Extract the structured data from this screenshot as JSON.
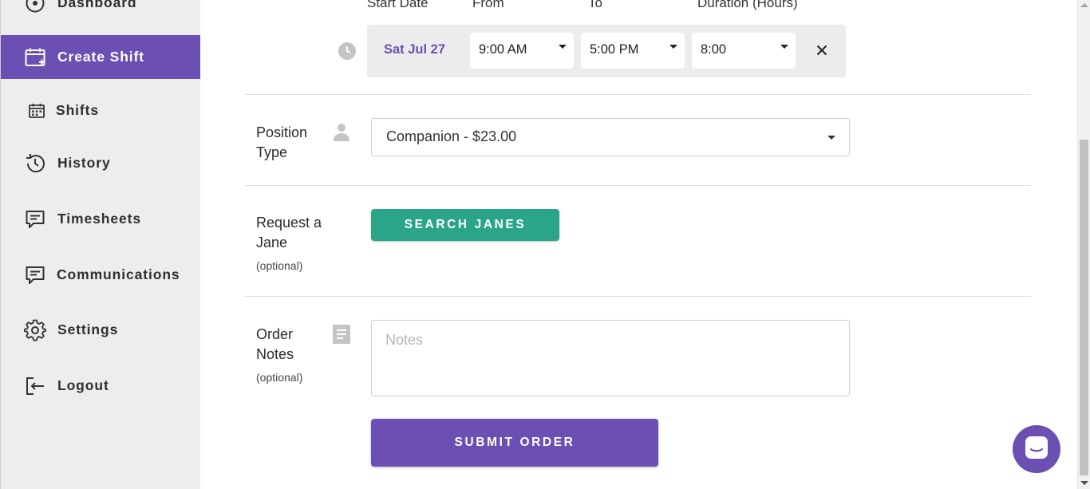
{
  "sidebar": {
    "items": [
      {
        "label": "Dashboard",
        "icon": "dashboard-icon",
        "active": false
      },
      {
        "label": "Create Shift",
        "icon": "calendar-plus-icon",
        "active": true
      },
      {
        "label": "Shifts",
        "icon": "calendar-icon",
        "active": false
      },
      {
        "label": "History",
        "icon": "history-icon",
        "active": false
      },
      {
        "label": "Timesheets",
        "icon": "timesheet-icon",
        "active": false
      },
      {
        "label": "Communications",
        "icon": "message-icon",
        "active": false
      },
      {
        "label": "Settings",
        "icon": "gear-icon",
        "active": false
      },
      {
        "label": "Logout",
        "icon": "logout-icon",
        "active": false
      }
    ]
  },
  "shift": {
    "headers": {
      "start_date": "Start Date",
      "from": "From",
      "to": "To",
      "duration": "Duration (Hours)"
    },
    "date": "Sat Jul 27",
    "from": "9:00 AM",
    "to": "5:00 PM",
    "duration": "8:00"
  },
  "position": {
    "label_line1": "Position",
    "label_line2": "Type",
    "value": "Companion - $23.00"
  },
  "request": {
    "label_line1": "Request a",
    "label_line2": "Jane",
    "optional": "(optional)",
    "button": "SEARCH JANES"
  },
  "notes": {
    "label_line1": "Order",
    "label_line2": "Notes",
    "optional": "(optional)",
    "placeholder": "Notes",
    "value": ""
  },
  "submit": {
    "label": "SUBMIT ORDER"
  },
  "colors": {
    "accent": "#6b4fb3",
    "search_button": "#2aa58a",
    "sidebar_bg": "#ededed"
  }
}
